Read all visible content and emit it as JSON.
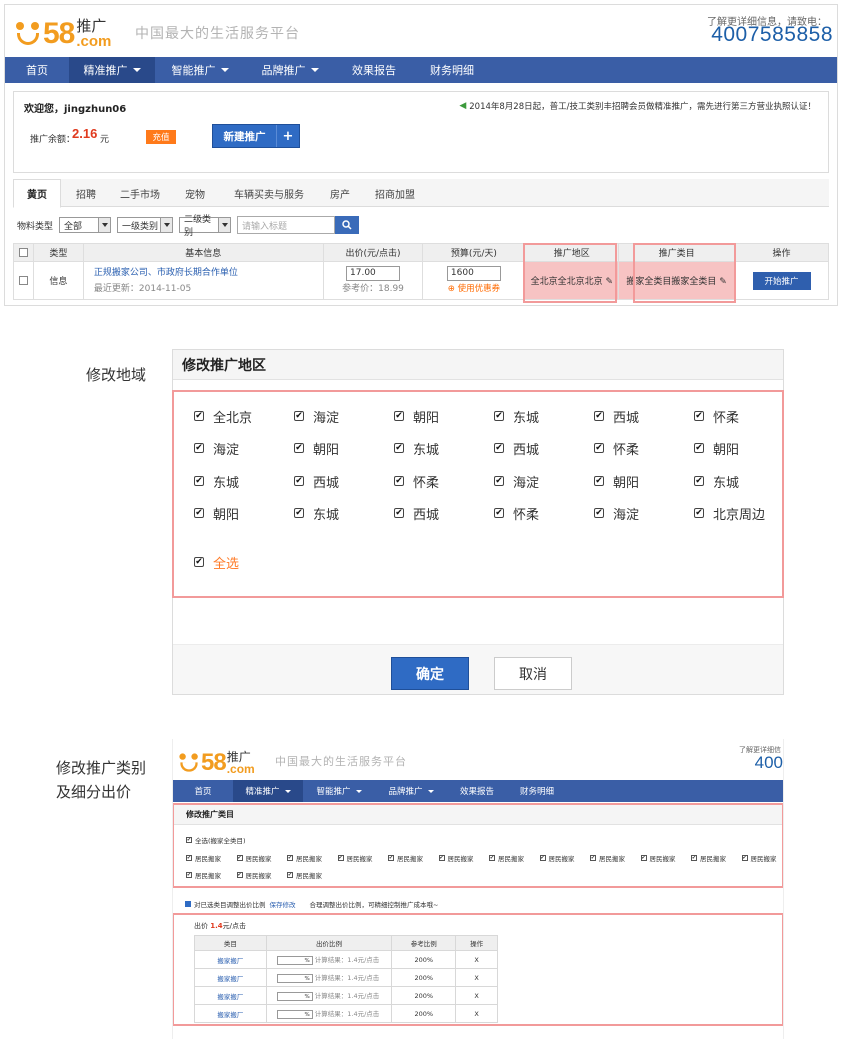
{
  "header": {
    "logo_tuiguang": "推广",
    "logo_58": "58",
    "logo_com": ".com",
    "slogan": "中国最大的生活服务平台",
    "hotline_label": "了解更详细信息，请致电：",
    "hotline_number": "4007585858"
  },
  "nav": [
    {
      "label": "首页",
      "dropdown": false
    },
    {
      "label": "精准推广",
      "dropdown": true
    },
    {
      "label": "智能推广",
      "dropdown": true
    },
    {
      "label": "品牌推广",
      "dropdown": true
    },
    {
      "label": "效果报告",
      "dropdown": false
    },
    {
      "label": "财务明细",
      "dropdown": false
    }
  ],
  "account": {
    "welcome": "欢迎您，jingzhun06",
    "notice": "2014年8月28日起，普工/技工类别丰招聘会员做精准推广，需先进行第三方营业执照认证！",
    "balance_label": "推广余额：",
    "balance_value": "2.16",
    "balance_unit": "元",
    "recharge": "充值",
    "new_promo": "新建推广",
    "new_promo_plus": "+"
  },
  "tabs": [
    "黄页",
    "招聘",
    "二手市场",
    "宠物",
    "车辆买卖与服务",
    "房产",
    "招商加盟"
  ],
  "filter": {
    "label": "物料类型",
    "type": "全部",
    "cat1": "一级类别",
    "cat2": "二级类别",
    "search_placeholder": "请输入标题"
  },
  "table": {
    "headers": [
      "类型",
      "基本信息",
      "出价(元/点击)",
      "预算(元/天)",
      "推广地区",
      "推广类目",
      "操作"
    ],
    "row": {
      "type": "信息",
      "title": "正规搬家公司、市政府长期合作单位",
      "updated": "最近更新：2014-11-05",
      "bid": "17.00",
      "ref_price": "参考价：18.99",
      "budget": "1600",
      "coupon": "使用优惠券",
      "region": "全北京全北京北京",
      "category": "搬家全类目搬家全类目",
      "action": "开始推广"
    }
  },
  "region_dialog": {
    "side_label": "修改地域",
    "title": "修改推广地区",
    "rows": [
      [
        "全北京",
        "海淀",
        "朝阳",
        "东城",
        "西城",
        "怀柔"
      ],
      [
        "海淀",
        "朝阳",
        "东城",
        "西城",
        "怀柔",
        "朝阳"
      ],
      [
        "东城",
        "西城",
        "怀柔",
        "海淀",
        "朝阳",
        "东城"
      ],
      [
        "朝阳",
        "东城",
        "西城",
        "怀柔",
        "海淀",
        "北京周边"
      ]
    ],
    "select_all": "全选",
    "ok": "确定",
    "cancel": "取消"
  },
  "category_panel": {
    "side_label_line1": "修改推广类别",
    "side_label_line2": "及细分出价",
    "hotline_partial": "400",
    "hotline_label_partial": "了解更详细信",
    "box_title": "修改推广类目",
    "select_all": "全选(搬家全类目)",
    "items": [
      "居民搬家",
      "居民搬家",
      "居民搬家",
      "居民搬家",
      "居民搬家",
      "居民搬家",
      "居民搬家",
      "居民搬家",
      "居民搬家",
      "居民搬家",
      "居民搬家",
      "居民搬家",
      "居民搬家",
      "居民搬家",
      "居民搬家"
    ],
    "adjust_label": "对已选类目调整出价比例",
    "save_link": "保存修改",
    "adjust_hint": "合理调整出价比例，可精细控制推广成本哦~",
    "bid_prefix": "出价",
    "bid_value": "1.4",
    "bid_unit": "元/点击",
    "table_headers": [
      "类目",
      "出价比例",
      "参考比例",
      "操作"
    ],
    "rows": [
      {
        "name": "搬家搬厂",
        "result": "计算结果：1.4元/点击",
        "ref": "200%",
        "op": "X"
      },
      {
        "name": "搬家搬厂",
        "result": "计算结果：1.4元/点击",
        "ref": "200%",
        "op": "X"
      },
      {
        "name": "搬家搬厂",
        "result": "计算结果：1.4元/点击",
        "ref": "200%",
        "op": "X"
      },
      {
        "name": "搬家搬厂",
        "result": "计算结果：1.4元/点击",
        "ref": "200%",
        "op": "X"
      }
    ],
    "percent_sign": "%"
  },
  "colors": {
    "nav_bg": "#3a5ea6",
    "nav_active": "#29498a",
    "brand_orange": "#f29c1f",
    "highlight_border": "#f29a9a",
    "balance_red": "#e03a1e",
    "link_blue": "#2a5fb0"
  }
}
